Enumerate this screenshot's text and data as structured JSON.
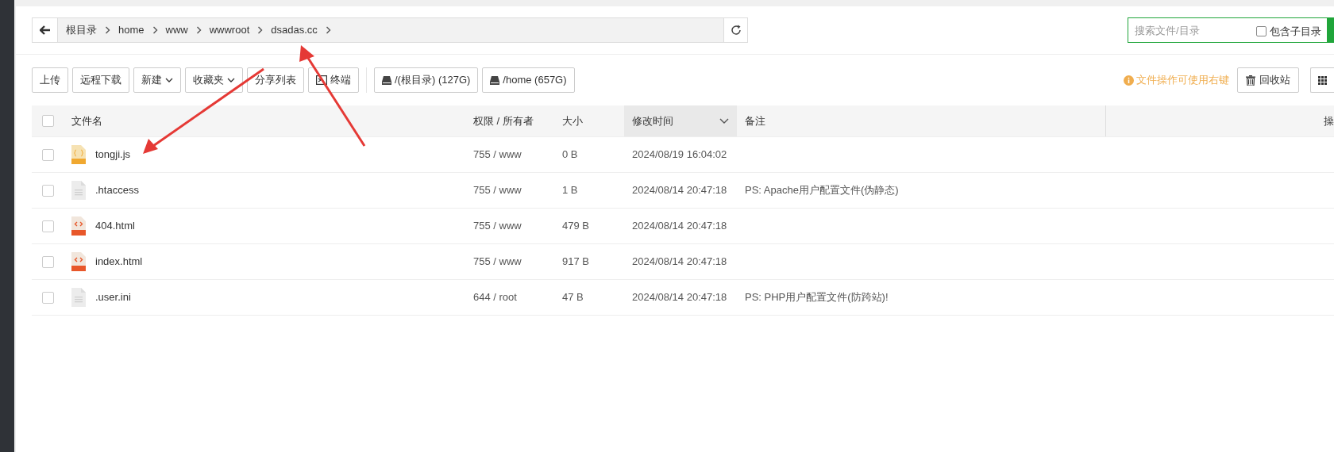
{
  "breadcrumb": [
    "根目录",
    "home",
    "www",
    "wwwroot",
    "dsadas.cc"
  ],
  "search": {
    "placeholder": "搜索文件/目录",
    "include_subdirs": {
      "label": "包含子目录",
      "checked": false
    }
  },
  "toolbar": [
    {
      "label": "上传",
      "kind": "plain"
    },
    {
      "label": "远程下载",
      "kind": "plain"
    },
    {
      "label": "新建",
      "kind": "dropdown"
    },
    {
      "label": "收藏夹",
      "kind": "dropdown"
    },
    {
      "label": "分享列表",
      "kind": "plain"
    },
    {
      "label": "终端",
      "kind": "terminal"
    },
    {
      "label": "/(根目录) (127G)",
      "kind": "disk"
    },
    {
      "label": "/home (657G)",
      "kind": "disk"
    }
  ],
  "hint": "文件操作可使用右键",
  "recycle_button": "回收站",
  "table": {
    "select_all": false,
    "columns": [
      "文件名",
      "权限 / 所有者",
      "大小",
      "修改时间",
      "备注",
      "操"
    ],
    "rows": [
      {
        "checked": false,
        "kind": "js",
        "name": "tongji.js",
        "perm": "755 / www",
        "size": "0 B",
        "mtime": "2024/08/19 16:04:02"
      },
      {
        "checked": false,
        "kind": "text",
        "name": ".htaccess",
        "perm": "755 / www",
        "size": "1 B",
        "mtime": "2024/08/14 20:47:18",
        "note": "PS: Apache用户配置文件(伪静态)"
      },
      {
        "checked": false,
        "kind": "html",
        "name": "404.html",
        "perm": "755 / www",
        "size": "479 B",
        "mtime": "2024/08/14 20:47:18"
      },
      {
        "checked": false,
        "kind": "html",
        "name": "index.html",
        "perm": "755 / www",
        "size": "917 B",
        "mtime": "2024/08/14 20:47:18"
      },
      {
        "checked": false,
        "kind": "text",
        "name": ".user.ini",
        "perm": "644 / root",
        "size": "47 B",
        "mtime": "2024/08/14 20:47:18",
        "note": "PS: PHP用户配置文件(防跨站)!"
      }
    ]
  }
}
